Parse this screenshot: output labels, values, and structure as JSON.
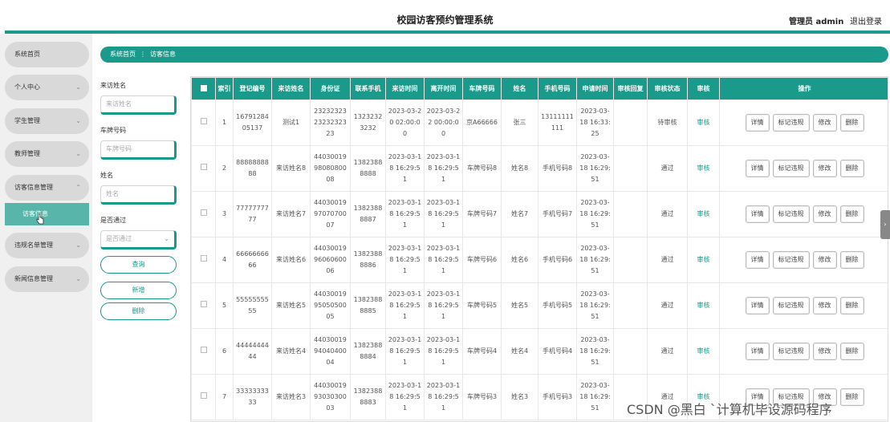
{
  "header": {
    "title": "校园访客预约管理系统",
    "admin": "管理员 admin",
    "logout": "退出登录"
  },
  "sidebar": {
    "items": [
      {
        "label": "系统首页",
        "chev": ""
      },
      {
        "label": "个人中心",
        "chev": "⌄"
      },
      {
        "label": "学生管理",
        "chev": "⌄"
      },
      {
        "label": "教师管理",
        "chev": "⌄"
      },
      {
        "label": "访客信息管理",
        "chev": "⌃"
      },
      {
        "label": "违规名单管理",
        "chev": "⌄"
      },
      {
        "label": "新闻信息管理",
        "chev": "⌄"
      }
    ],
    "sub_item": "访客信息"
  },
  "breadcrumb": {
    "home": "系统首页",
    "sep": "⋮",
    "current": "访客信息"
  },
  "filters": {
    "visitor_name_label": "来访姓名",
    "visitor_name_placeholder": "来访姓名",
    "plate_label": "车牌号码",
    "plate_placeholder": "车牌号码",
    "name_label": "姓名",
    "name_placeholder": "姓名",
    "passed_label": "是否通过",
    "passed_placeholder": "是否通过",
    "query_button": "查询",
    "add_button": "新增",
    "delete_button": "删除"
  },
  "table": {
    "headers": [
      "索引",
      "登记编号",
      "来访姓名",
      "身份证",
      "联系手机",
      "来访时间",
      "离开时间",
      "车牌号码",
      "姓名",
      "手机号码",
      "申请时间",
      "审核回复",
      "审核状态",
      "审核",
      "操作"
    ],
    "rows": [
      {
        "index": "1",
        "reg_no": "1679128405137",
        "visitor": "测试1",
        "id_card": "232323232323232323",
        "phone": "13232323232",
        "visit_time": "2023-03-20 02:00:00",
        "leave_time": "2023-03-22 00:00:00",
        "plate": "京A66666",
        "name": "张三",
        "mobile": "13111111111",
        "apply_time": "2023-03-18 16:33:25",
        "reply": "",
        "status": "待审核",
        "audit": "审核"
      },
      {
        "index": "2",
        "reg_no": "8888888888",
        "visitor": "来访姓名8",
        "id_card": "440300199808080008",
        "phone": "13823888888",
        "visit_time": "2023-03-18 16:29:51",
        "leave_time": "2023-03-18 16:29:51",
        "plate": "车牌号码8",
        "name": "姓名8",
        "mobile": "手机号码8",
        "apply_time": "2023-03-18 16:29:51",
        "reply": "",
        "status": "通过",
        "audit": "审核"
      },
      {
        "index": "3",
        "reg_no": "7777777777",
        "visitor": "来访姓名7",
        "id_card": "440300199707070007",
        "phone": "13823888887",
        "visit_time": "2023-03-18 16:29:51",
        "leave_time": "2023-03-18 16:29:51",
        "plate": "车牌号码7",
        "name": "姓名7",
        "mobile": "手机号码7",
        "apply_time": "2023-03-18 16:29:51",
        "reply": "",
        "status": "通过",
        "audit": "审核"
      },
      {
        "index": "4",
        "reg_no": "6666666666",
        "visitor": "来访姓名6",
        "id_card": "440300199606060006",
        "phone": "13823888886",
        "visit_time": "2023-03-18 16:29:51",
        "leave_time": "2023-03-18 16:29:51",
        "plate": "车牌号码6",
        "name": "姓名6",
        "mobile": "手机号码6",
        "apply_time": "2023-03-18 16:29:51",
        "reply": "",
        "status": "通过",
        "audit": "审核"
      },
      {
        "index": "5",
        "reg_no": "5555555555",
        "visitor": "来访姓名5",
        "id_card": "440300199505050005",
        "phone": "13823888885",
        "visit_time": "2023-03-18 16:29:51",
        "leave_time": "2023-03-18 16:29:51",
        "plate": "车牌号码5",
        "name": "姓名5",
        "mobile": "手机号码5",
        "apply_time": "2023-03-18 16:29:51",
        "reply": "",
        "status": "通过",
        "audit": "审核"
      },
      {
        "index": "6",
        "reg_no": "4444444444",
        "visitor": "来访姓名4",
        "id_card": "440300199404040004",
        "phone": "13823888884",
        "visit_time": "2023-03-18 16:29:51",
        "leave_time": "2023-03-18 16:29:51",
        "plate": "车牌号码4",
        "name": "姓名4",
        "mobile": "手机号码4",
        "apply_time": "2023-03-18 16:29:51",
        "reply": "",
        "status": "通过",
        "audit": "审核"
      },
      {
        "index": "7",
        "reg_no": "3333333333",
        "visitor": "来访姓名3",
        "id_card": "440300199303030003",
        "phone": "13823888883",
        "visit_time": "2023-03-18 16:29:51",
        "leave_time": "2023-03-18 16:29:51",
        "plate": "车牌号码3",
        "name": "姓名3",
        "mobile": "手机号码3",
        "apply_time": "2023-03-18 16:29:51",
        "reply": "",
        "status": "通过",
        "audit": "审核"
      }
    ],
    "actions": {
      "detail": "详情",
      "mark": "标记违规",
      "edit": "修改",
      "delete": "删除"
    }
  },
  "scroll_handle": "›",
  "watermark": "CSDN @黑白 `计算机毕设源码程序"
}
